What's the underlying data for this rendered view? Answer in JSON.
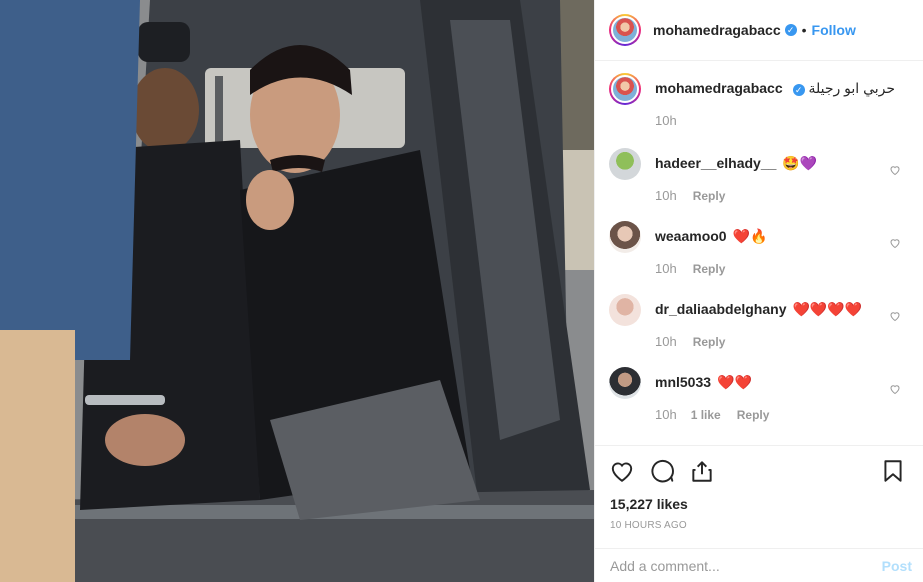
{
  "photo": {
    "alt_icon": "post-photo"
  },
  "header": {
    "username": "mohamedragabacc",
    "verified": "✓",
    "separator": "•",
    "follow_label": "Follow"
  },
  "caption": {
    "username": "mohamedragabacc",
    "text": "حربي ابو رجيلة",
    "time": "10h"
  },
  "comments": [
    {
      "username": "hadeer__elhady__",
      "text": "🤩💜",
      "time": "10h",
      "likes": "",
      "reply": "Reply"
    },
    {
      "username": "weaamoo0",
      "text": "❤️🔥",
      "time": "10h",
      "likes": "",
      "reply": "Reply"
    },
    {
      "username": "dr_daliaabdelghany",
      "text": "❤️❤️❤️❤️",
      "time": "10h",
      "likes": "",
      "reply": "Reply"
    },
    {
      "username": "mnl5033",
      "text": "❤️❤️",
      "time": "10h",
      "likes": "1 like",
      "reply": "Reply"
    }
  ],
  "stats": {
    "likes": "15,227 likes",
    "ago": "10 HOURS AGO"
  },
  "compose": {
    "placeholder": "Add a comment...",
    "post_label": "Post"
  },
  "colors": {
    "accent": "#3897f0",
    "post_disabled": "#b2dffc",
    "muted": "#999999"
  }
}
